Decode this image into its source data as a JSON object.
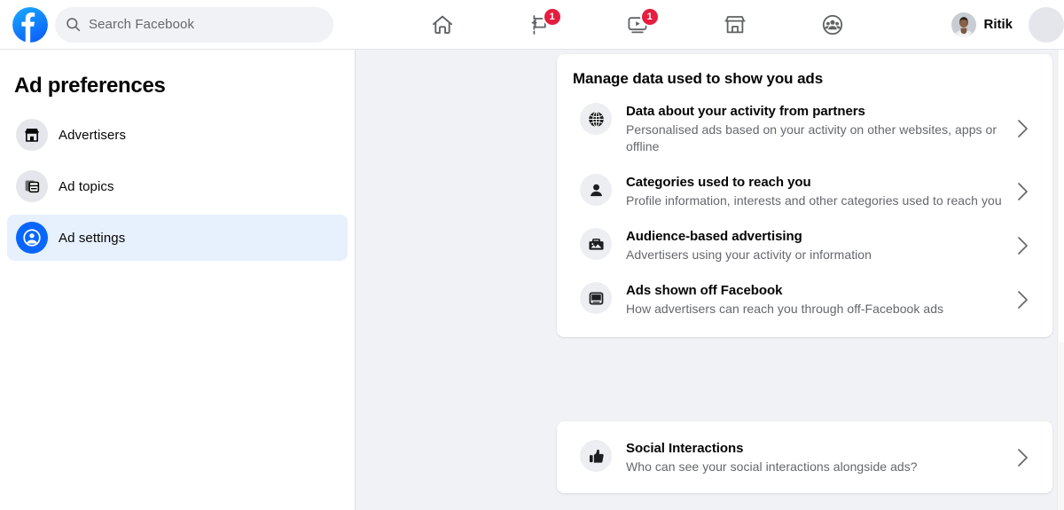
{
  "topbar": {
    "logo_icon": "facebook-logo",
    "search": {
      "icon": "search-icon",
      "placeholder": "Search Facebook",
      "value": ""
    },
    "tabs": [
      {
        "name": "home",
        "icon": "home-icon",
        "badge": ""
      },
      {
        "name": "pages",
        "icon": "flag-icon",
        "badge": "1"
      },
      {
        "name": "watch",
        "icon": "video-play-icon",
        "badge": "1"
      },
      {
        "name": "marketplace",
        "icon": "storefront-icon",
        "badge": ""
      },
      {
        "name": "groups",
        "icon": "groups-icon",
        "badge": ""
      }
    ],
    "profile": {
      "avatar_icon": "user-avatar",
      "name": "Ritik"
    },
    "menu_button_icon": "menu-icon",
    "badge_color": "#e41e3f"
  },
  "sidebar": {
    "title": "Ad preferences",
    "active_color": "#0866ff",
    "items": [
      {
        "label": "Advertisers",
        "icon": "storefront-icon",
        "active": false
      },
      {
        "label": "Ad topics",
        "icon": "layers-icon",
        "active": false
      },
      {
        "label": "Ad settings",
        "icon": "account-circle-icon",
        "active": true
      }
    ]
  },
  "main": {
    "primary_card": {
      "heading": "Manage data used to show you ads",
      "rows": [
        {
          "icon": "globe-icon",
          "title": "Data about your activity from partners",
          "subtitle": "Personalised ads based on your activity on other websites, apps or offline",
          "chevron": "chevron-right-icon"
        },
        {
          "icon": "person-icon",
          "title": "Categories used to reach you",
          "subtitle": "Profile information, interests and other categories used to reach you",
          "chevron": "chevron-right-icon"
        },
        {
          "icon": "briefcase-image-icon",
          "title": "Audience-based advertising",
          "subtitle": "Advertisers using your activity or information",
          "chevron": "chevron-right-icon"
        },
        {
          "icon": "device-screen-icon",
          "title": "Ads shown off Facebook",
          "subtitle": "How advertisers can reach you through off-Facebook ads",
          "chevron": "chevron-right-icon"
        }
      ]
    },
    "secondary_card": {
      "rows": [
        {
          "icon": "thumbs-up-icon",
          "title": "Social Interactions",
          "subtitle": "Who can see your social interactions alongside ads?",
          "chevron": "chevron-right-icon"
        }
      ]
    }
  }
}
